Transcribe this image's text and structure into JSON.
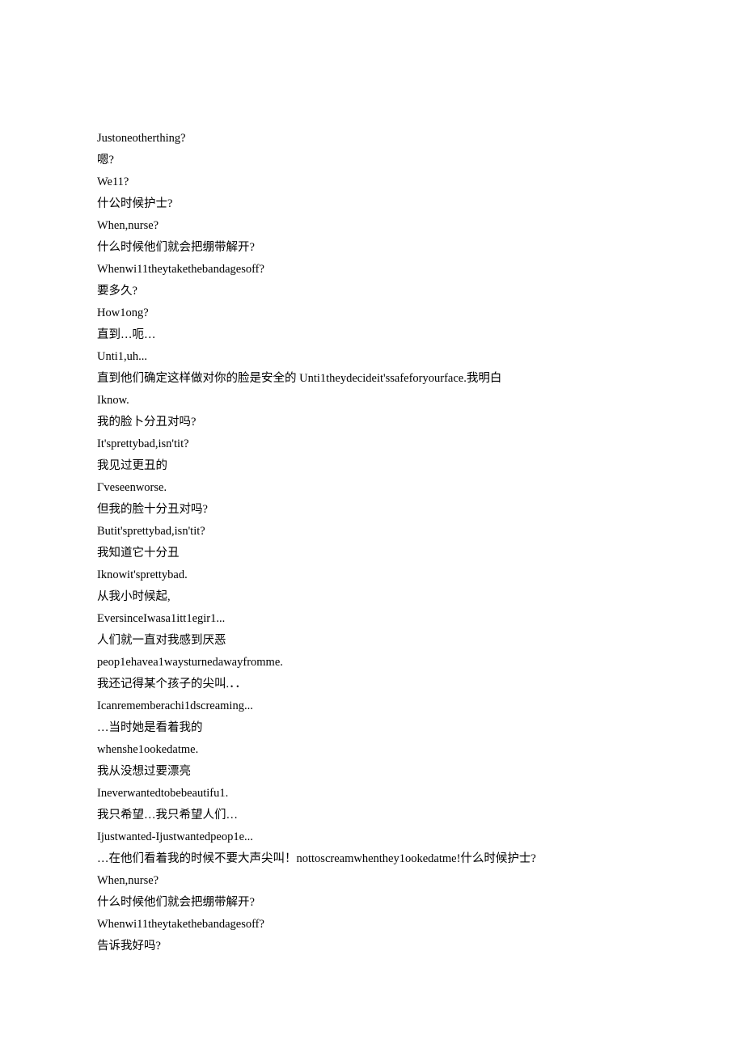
{
  "lines": [
    "Justoneotherthing?",
    "嗯?",
    "We11?",
    "什公时候护士?",
    "When,nurse?",
    "什么时候他们就会把绷带解开?",
    "Whenwi11theytakethebandagesoff?",
    "要多久?",
    "How1ong?",
    "直到…呃…",
    "Unti1,uh...",
    "直到他们确定这样做对你的脸是安全的 Unti1theydecideit'ssafeforyourface.我明白",
    "Iknow.",
    "我的脸卜分丑对吗?",
    "It'sprettybad,isn'tit?",
    "我见过更丑的",
    "Гveseenworse.",
    "但我的脸十分丑对吗?",
    "Butit'sprettybad,isn'tit?",
    "我知道它十分丑",
    "Iknowit'sprettybad.",
    "从我小时候起,",
    "EversinceIwasa1itt1egir1...",
    "人们就一直对我感到厌恶",
    "peop1ehavea1waysturnedawayfromme.",
    "我还记得某个孩子的尖叫.．．",
    "Icanrememberachi1dscreaming...",
    "…当时她是看着我的",
    "whenshe1ookedatme.",
    "我从没想过要漂亮",
    "Ineverwantedtobebeautifu1.",
    "我只希望…我只希望人们…",
    "Ijustwanted-Ijustwantedpeop1e...",
    "…在他们看着我的时候不要大声尖叫！nottoscreamwhenthey1ookedatme!什么时候护士?",
    "When,nurse?",
    "什么时候他们就会把绷带解开?",
    "Whenwi11theytakethebandagesoff?",
    "告诉我好吗?"
  ]
}
